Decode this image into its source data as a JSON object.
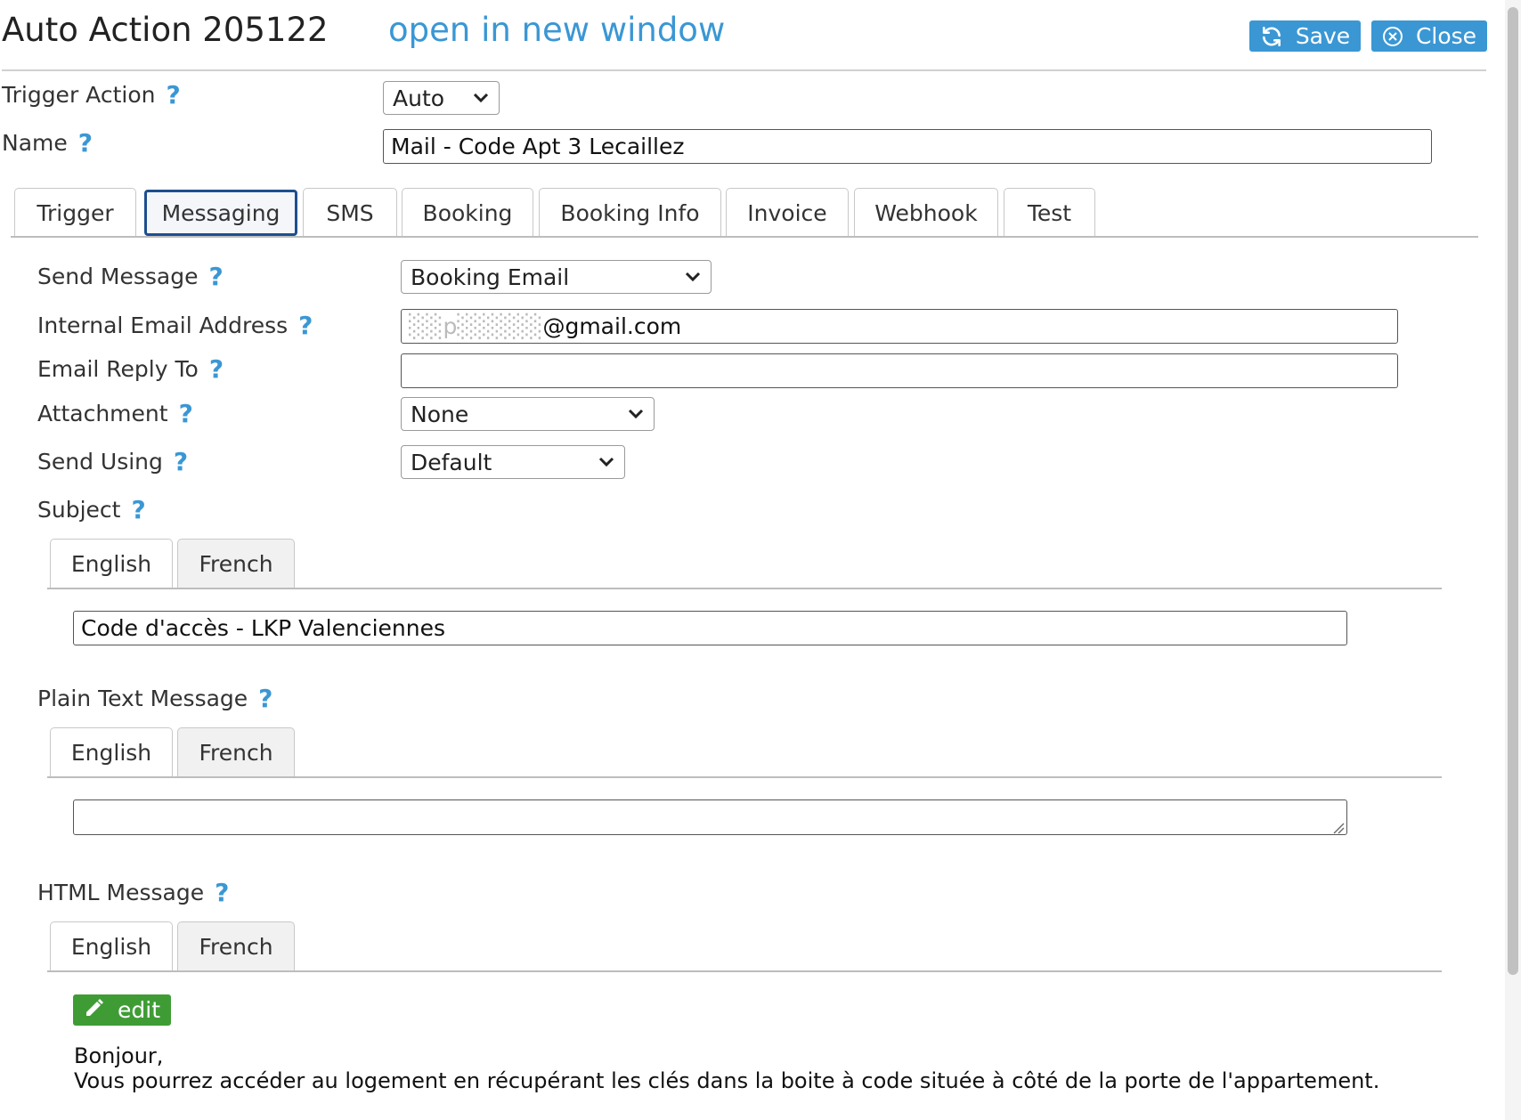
{
  "header": {
    "title": "Auto Action 205122",
    "open_link": "open in new window",
    "save_label": "Save",
    "close_label": "Close",
    "accent_color": "#3a97d4"
  },
  "form_top": {
    "trigger_action_label": "Trigger Action",
    "trigger_action_value": "Auto",
    "name_label": "Name",
    "name_value": "Mail - Code Apt 3 Lecaillez",
    "help_glyph": "?"
  },
  "tabs": [
    {
      "label": "Trigger"
    },
    {
      "label": "Messaging",
      "active": true
    },
    {
      "label": "SMS"
    },
    {
      "label": "Booking"
    },
    {
      "label": "Booking Info"
    },
    {
      "label": "Invoice"
    },
    {
      "label": "Webhook"
    },
    {
      "label": "Test"
    }
  ],
  "messaging": {
    "send_message_label": "Send Message",
    "send_message_value": "Booking Email",
    "internal_email_label": "Internal Email Address",
    "internal_email_value_obscured": "░░p░░░░░",
    "internal_email_value_visible": "@gmail.com",
    "reply_to_label": "Email Reply To",
    "reply_to_value": "",
    "attachment_label": "Attachment",
    "attachment_value": "None",
    "send_using_label": "Send Using",
    "send_using_value": "Default",
    "subject_label": "Subject",
    "subject_value": "Code d'accès - LKP Valenciennes",
    "plain_text_label": "Plain Text Message",
    "plain_text_value": "",
    "html_message_label": "HTML Message",
    "lang_tabs": [
      "English",
      "French"
    ],
    "selected_lang": "French",
    "edit_label": "edit",
    "edit_color": "#3f9c35",
    "html_preview_line1": "Bonjour,",
    "html_preview_line2": "Vous pourrez accéder au logement en récupérant les clés dans la boite à code située à côté de la porte de l'appartement."
  }
}
